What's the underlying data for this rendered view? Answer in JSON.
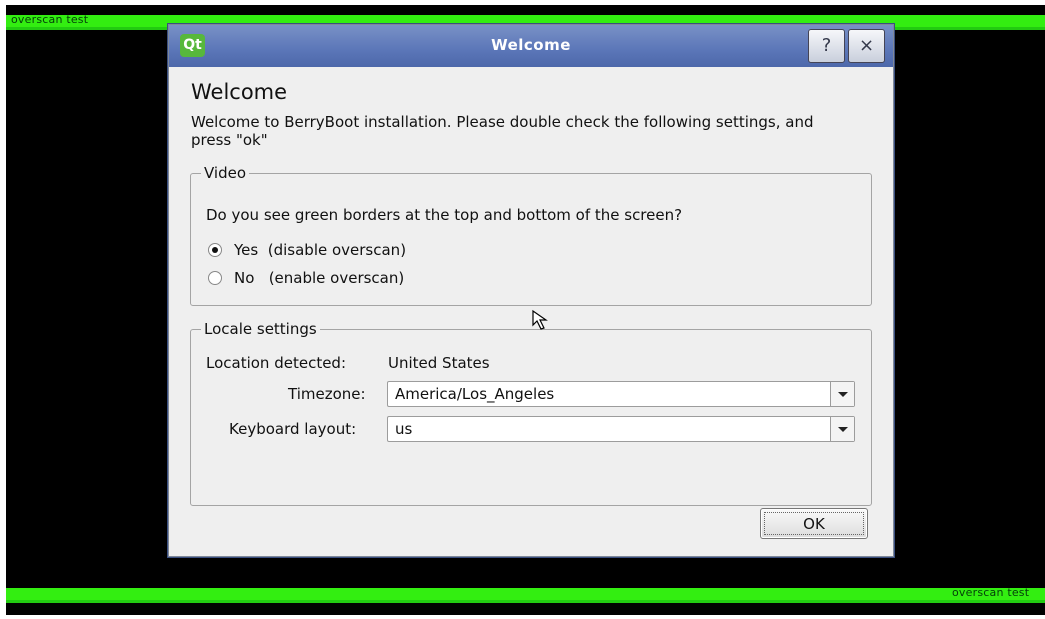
{
  "overscan": {
    "top_label": "overscan test",
    "bottom_label": "overscan test",
    "color": "#33ee11"
  },
  "window": {
    "title": "Welcome",
    "logo_text": "Qt",
    "help_glyph": "?",
    "close_glyph": "×",
    "titlebar_color": "#5b76b8"
  },
  "content": {
    "heading": "Welcome",
    "intro": "Welcome to BerryBoot installation. Please double check the following settings, and press \"ok\""
  },
  "video": {
    "group_title": "Video",
    "question": "Do you see green borders at the top and bottom of the screen?",
    "options": [
      {
        "label": "Yes  (disable overscan)",
        "selected": true
      },
      {
        "label": "No   (enable overscan)",
        "selected": false
      }
    ]
  },
  "locale": {
    "group_title": "Locale settings",
    "location_label": "Location detected:",
    "location_value": "United States",
    "timezone_label": "Timezone:",
    "timezone_value": "America/Los_Angeles",
    "keyboard_label": "Keyboard layout:",
    "keyboard_value": "us"
  },
  "buttons": {
    "ok_label": "OK"
  }
}
